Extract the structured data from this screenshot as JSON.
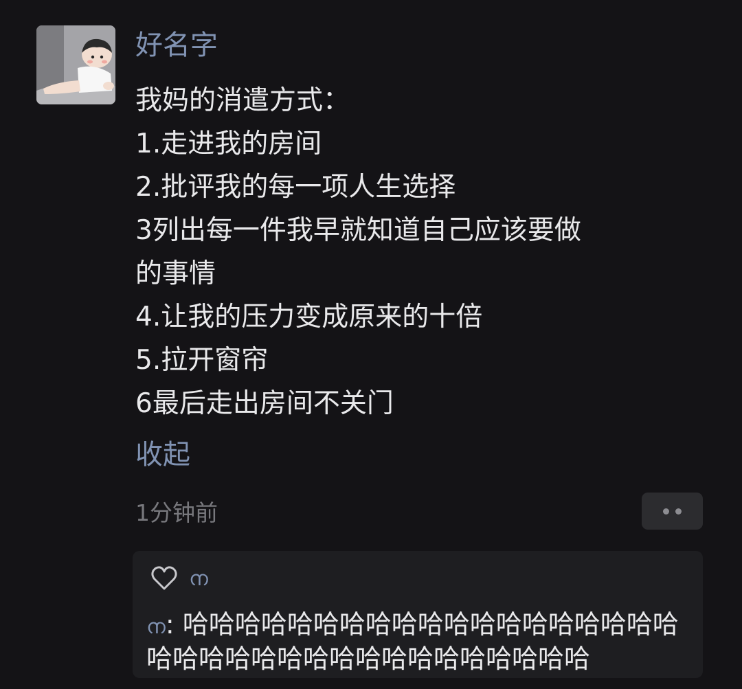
{
  "post": {
    "avatar_icon": "baby-avatar",
    "username": "好名字",
    "lines": [
      "我妈的消遣方式：",
      "1.走进我的房间",
      "2.批评我的每一项人生选择",
      "3列出每一件我早就知道自己应该要做",
      "的事情",
      "4.让我的压力变成原来的十倍",
      "5.拉开窗帘",
      "6最后走出房间不关门"
    ],
    "collapse_label": "收起",
    "time": "1分钟前",
    "more_icon": "more-dots-icon"
  },
  "interactions": {
    "like_icon": "heart-outline-icon",
    "liker": "ന",
    "comment_author": "ന",
    "comment_separator": ": ",
    "comment_text": "哈哈哈哈哈哈哈哈哈哈哈哈哈哈哈哈哈哈哈哈哈哈哈哈哈哈哈哈哈哈哈哈哈哈哈哈"
  },
  "colors": {
    "background": "#141316",
    "link": "#8193b3",
    "text": "#e9e9eb",
    "muted": "#78787d"
  }
}
